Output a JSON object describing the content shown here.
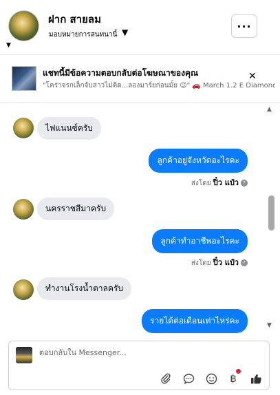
{
  "header": {
    "contact_name": "ฝาก สายลม",
    "assign_label": "มอบหมายการสนทนานี้",
    "more_label": "···"
  },
  "ad": {
    "title": "แชทนี้มีข้อความตอบกลับต่อโฆษณาของคุณ",
    "snippet": "\"โคร่าจรกเล็กจับสาวไม่ติด...ลองมาร์ยก่อนมั้ย 😉\" 🚗 March 1.2 E Diamond..."
  },
  "messages": [
    {
      "type": "incoming",
      "text": "ไฟแนนซ์ครับ"
    },
    {
      "type": "outgoing",
      "text": "ลูกค้าอยู่จังหวัดอะไรคะ",
      "sent_by_prefix": "ส่งโดย",
      "sent_by_name": "ปิ๋ว แป๋ว"
    },
    {
      "type": "incoming",
      "text": "นครราชสีมาครับ"
    },
    {
      "type": "outgoing",
      "text": "ลูกค้าทำอาชีพอะไรคะ",
      "sent_by_prefix": "ส่งโดย",
      "sent_by_name": "ปิ๋ว แป๋ว"
    },
    {
      "type": "incoming",
      "text": "ทำงานโรงน้ำตาลครับ"
    },
    {
      "type": "outgoing",
      "text": "รายได้ต่อเดือนเท่าไหร่คะ"
    }
  ],
  "composer": {
    "placeholder": "ตอบกลับใน Messenger..."
  },
  "icons": {
    "attach": "paperclip-icon",
    "saved_reply": "chat-bubble-icon",
    "emoji": "smiley-icon",
    "payment": "baht-icon",
    "like": "thumbs-up-icon"
  },
  "colors": {
    "outgoing_bubble": "#0a7cff",
    "incoming_bubble": "#e9eaed",
    "badge": "#e41e3f"
  }
}
